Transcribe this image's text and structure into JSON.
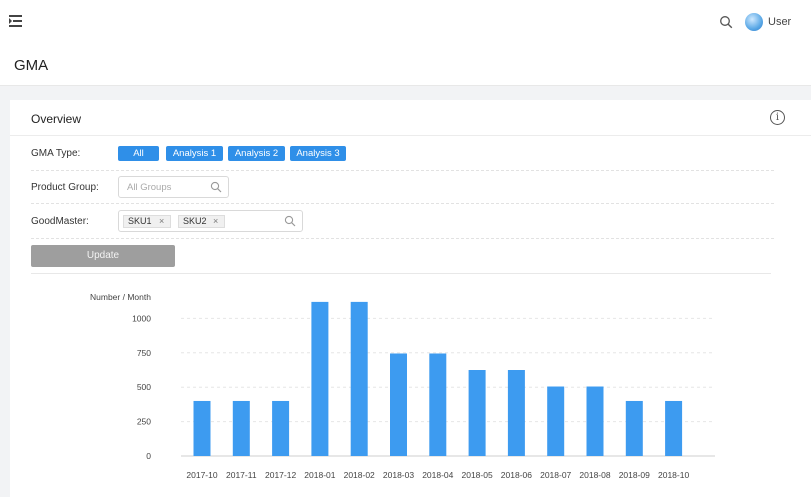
{
  "header": {
    "user_label": "User"
  },
  "page": {
    "title": "GMA"
  },
  "card": {
    "title": "Overview",
    "info_glyph": "i"
  },
  "filters": {
    "gma_type": {
      "label": "GMA Type:",
      "options": [
        "All",
        "Analysis 1",
        "Analysis 2",
        "Analysis 3"
      ],
      "selected": "All"
    },
    "product_group": {
      "label": "Product Group:",
      "placeholder": "All Groups"
    },
    "good_master": {
      "label": "GoodMaster:",
      "tags": [
        "SKU1",
        "SKU2"
      ],
      "remove_glyph": "×"
    }
  },
  "actions": {
    "update_label": "Update"
  },
  "colors": {
    "accent": "#2f8fe8",
    "bar": "#3d9bf0",
    "button_disabled": "#9e9e9e"
  },
  "chart_data": {
    "type": "bar",
    "ylabel": "Number / Month",
    "ylim": [
      0,
      1250
    ],
    "yticks": [
      0,
      250,
      500,
      750,
      1000
    ],
    "grid": true,
    "categories": [
      "2017-10",
      "2017-11",
      "2017-12",
      "2018-01",
      "2018-02",
      "2018-03",
      "2018-04",
      "2018-05",
      "2018-06",
      "2018-07",
      "2018-08",
      "2018-09",
      "2018-10"
    ],
    "values": [
      400,
      400,
      400,
      1120,
      1120,
      745,
      745,
      625,
      625,
      505,
      505,
      400,
      400
    ]
  }
}
